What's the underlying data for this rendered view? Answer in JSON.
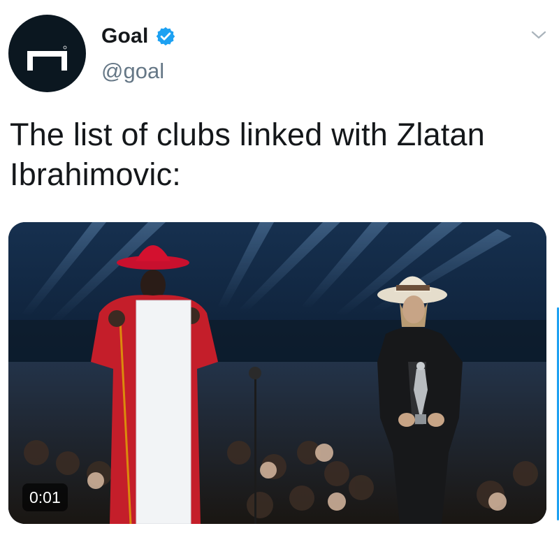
{
  "author": {
    "display_name": "Goal",
    "handle": "@goal",
    "verified": true,
    "avatar_icon": "goal-logo-icon",
    "avatar_color": "#0b1720"
  },
  "tweet": {
    "text": "The list of clubs linked with Zlatan Ibrahimovic:"
  },
  "media": {
    "type": "video",
    "duration": "0:01"
  },
  "menu": {
    "icon": "chevron-down-icon"
  },
  "colors": {
    "verified_blue": "#1da1f2",
    "text_primary": "#14171a",
    "text_secondary": "#657786"
  }
}
